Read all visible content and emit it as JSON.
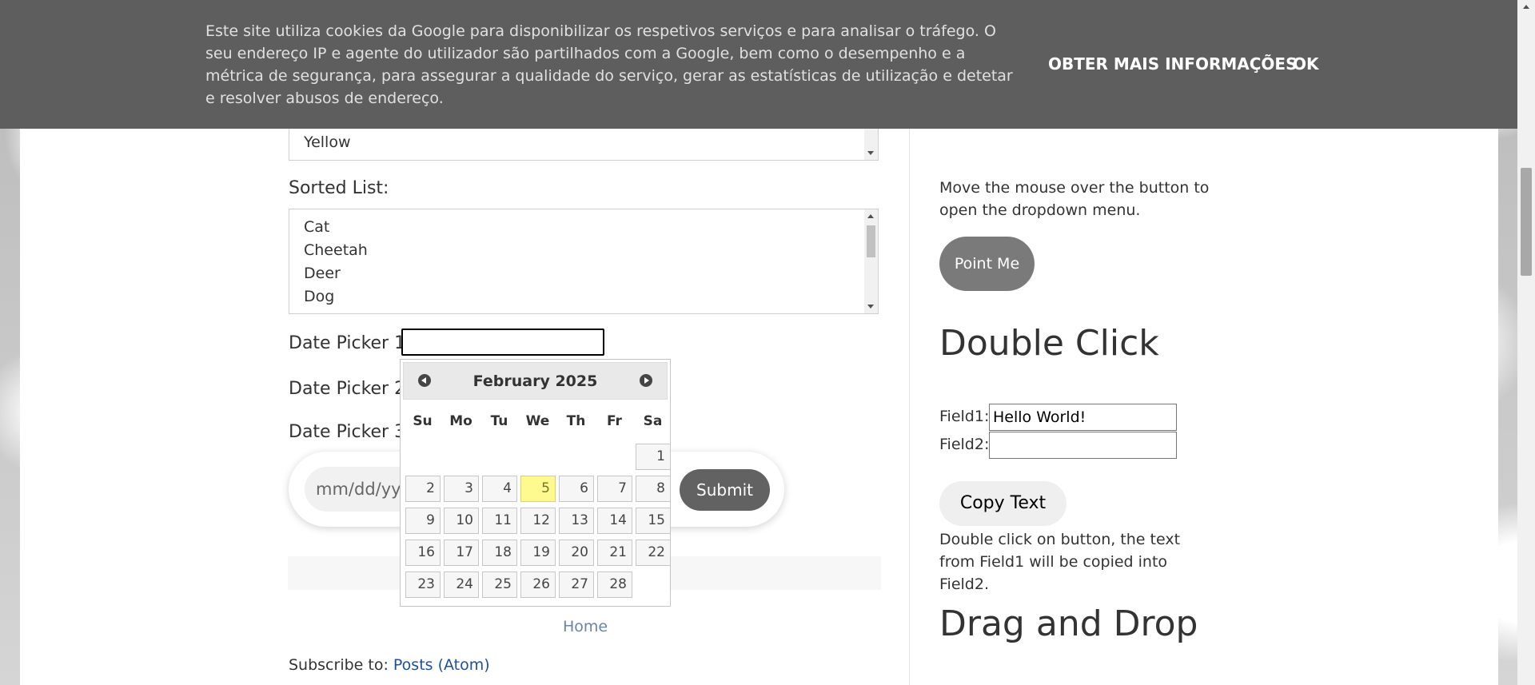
{
  "cookie_banner": {
    "text": "Este site utiliza cookies da Google para disponibilizar os respetivos serviços e para analisar o tráfego. O seu endereço IP e agente do utilizador são partilhados com a Google, bem como o desempenho e a métrica de segurança, para assegurar a qualidade do serviço, gerar as estatísticas de utilização e detetar e resolver abusos de endereço.",
    "more_info": "OBTER MAIS INFORMAÇÕES",
    "ok": "OK"
  },
  "colors_list": {
    "visible_item": "Yellow"
  },
  "sorted_list": {
    "label": "Sorted List:",
    "items": [
      "Cat",
      "Cheetah",
      "Deer",
      "Dog"
    ]
  },
  "date_pickers": {
    "dp1_label": "Date Picker 1:",
    "dp2_label": "Date Picker 2:",
    "dp3_label": "Date Picker 3:",
    "dp3_placeholder": "mm/dd/yyy",
    "submit": "Submit"
  },
  "calendar": {
    "month_title": "February 2025",
    "weekdays": [
      "Su",
      "Mo",
      "Tu",
      "We",
      "Th",
      "Fr",
      "Sa"
    ],
    "days": [
      "1",
      "2",
      "3",
      "4",
      "5",
      "6",
      "7",
      "8",
      "9",
      "10",
      "11",
      "12",
      "13",
      "14",
      "15",
      "16",
      "17",
      "18",
      "19",
      "20",
      "21",
      "22",
      "23",
      "24",
      "25",
      "26",
      "27",
      "28"
    ],
    "today": "5"
  },
  "footer": {
    "home": "Home",
    "subscribe_prefix": "Subscribe to: ",
    "subscribe_link": "Posts (Atom)"
  },
  "sidebar": {
    "mouse_hover": {
      "description": "Move the mouse over the button to open the dropdown menu.",
      "button": "Point Me"
    },
    "double_click": {
      "heading": "Double Click",
      "field1_label": "Field1:",
      "field1_value": "Hello World!",
      "field2_label": "Field2:",
      "field2_value": "",
      "button": "Copy Text",
      "description": "Double click on button, the text from Field1 will be copied into Field2."
    },
    "drag_and_drop": {
      "heading": "Drag and Drop"
    }
  }
}
